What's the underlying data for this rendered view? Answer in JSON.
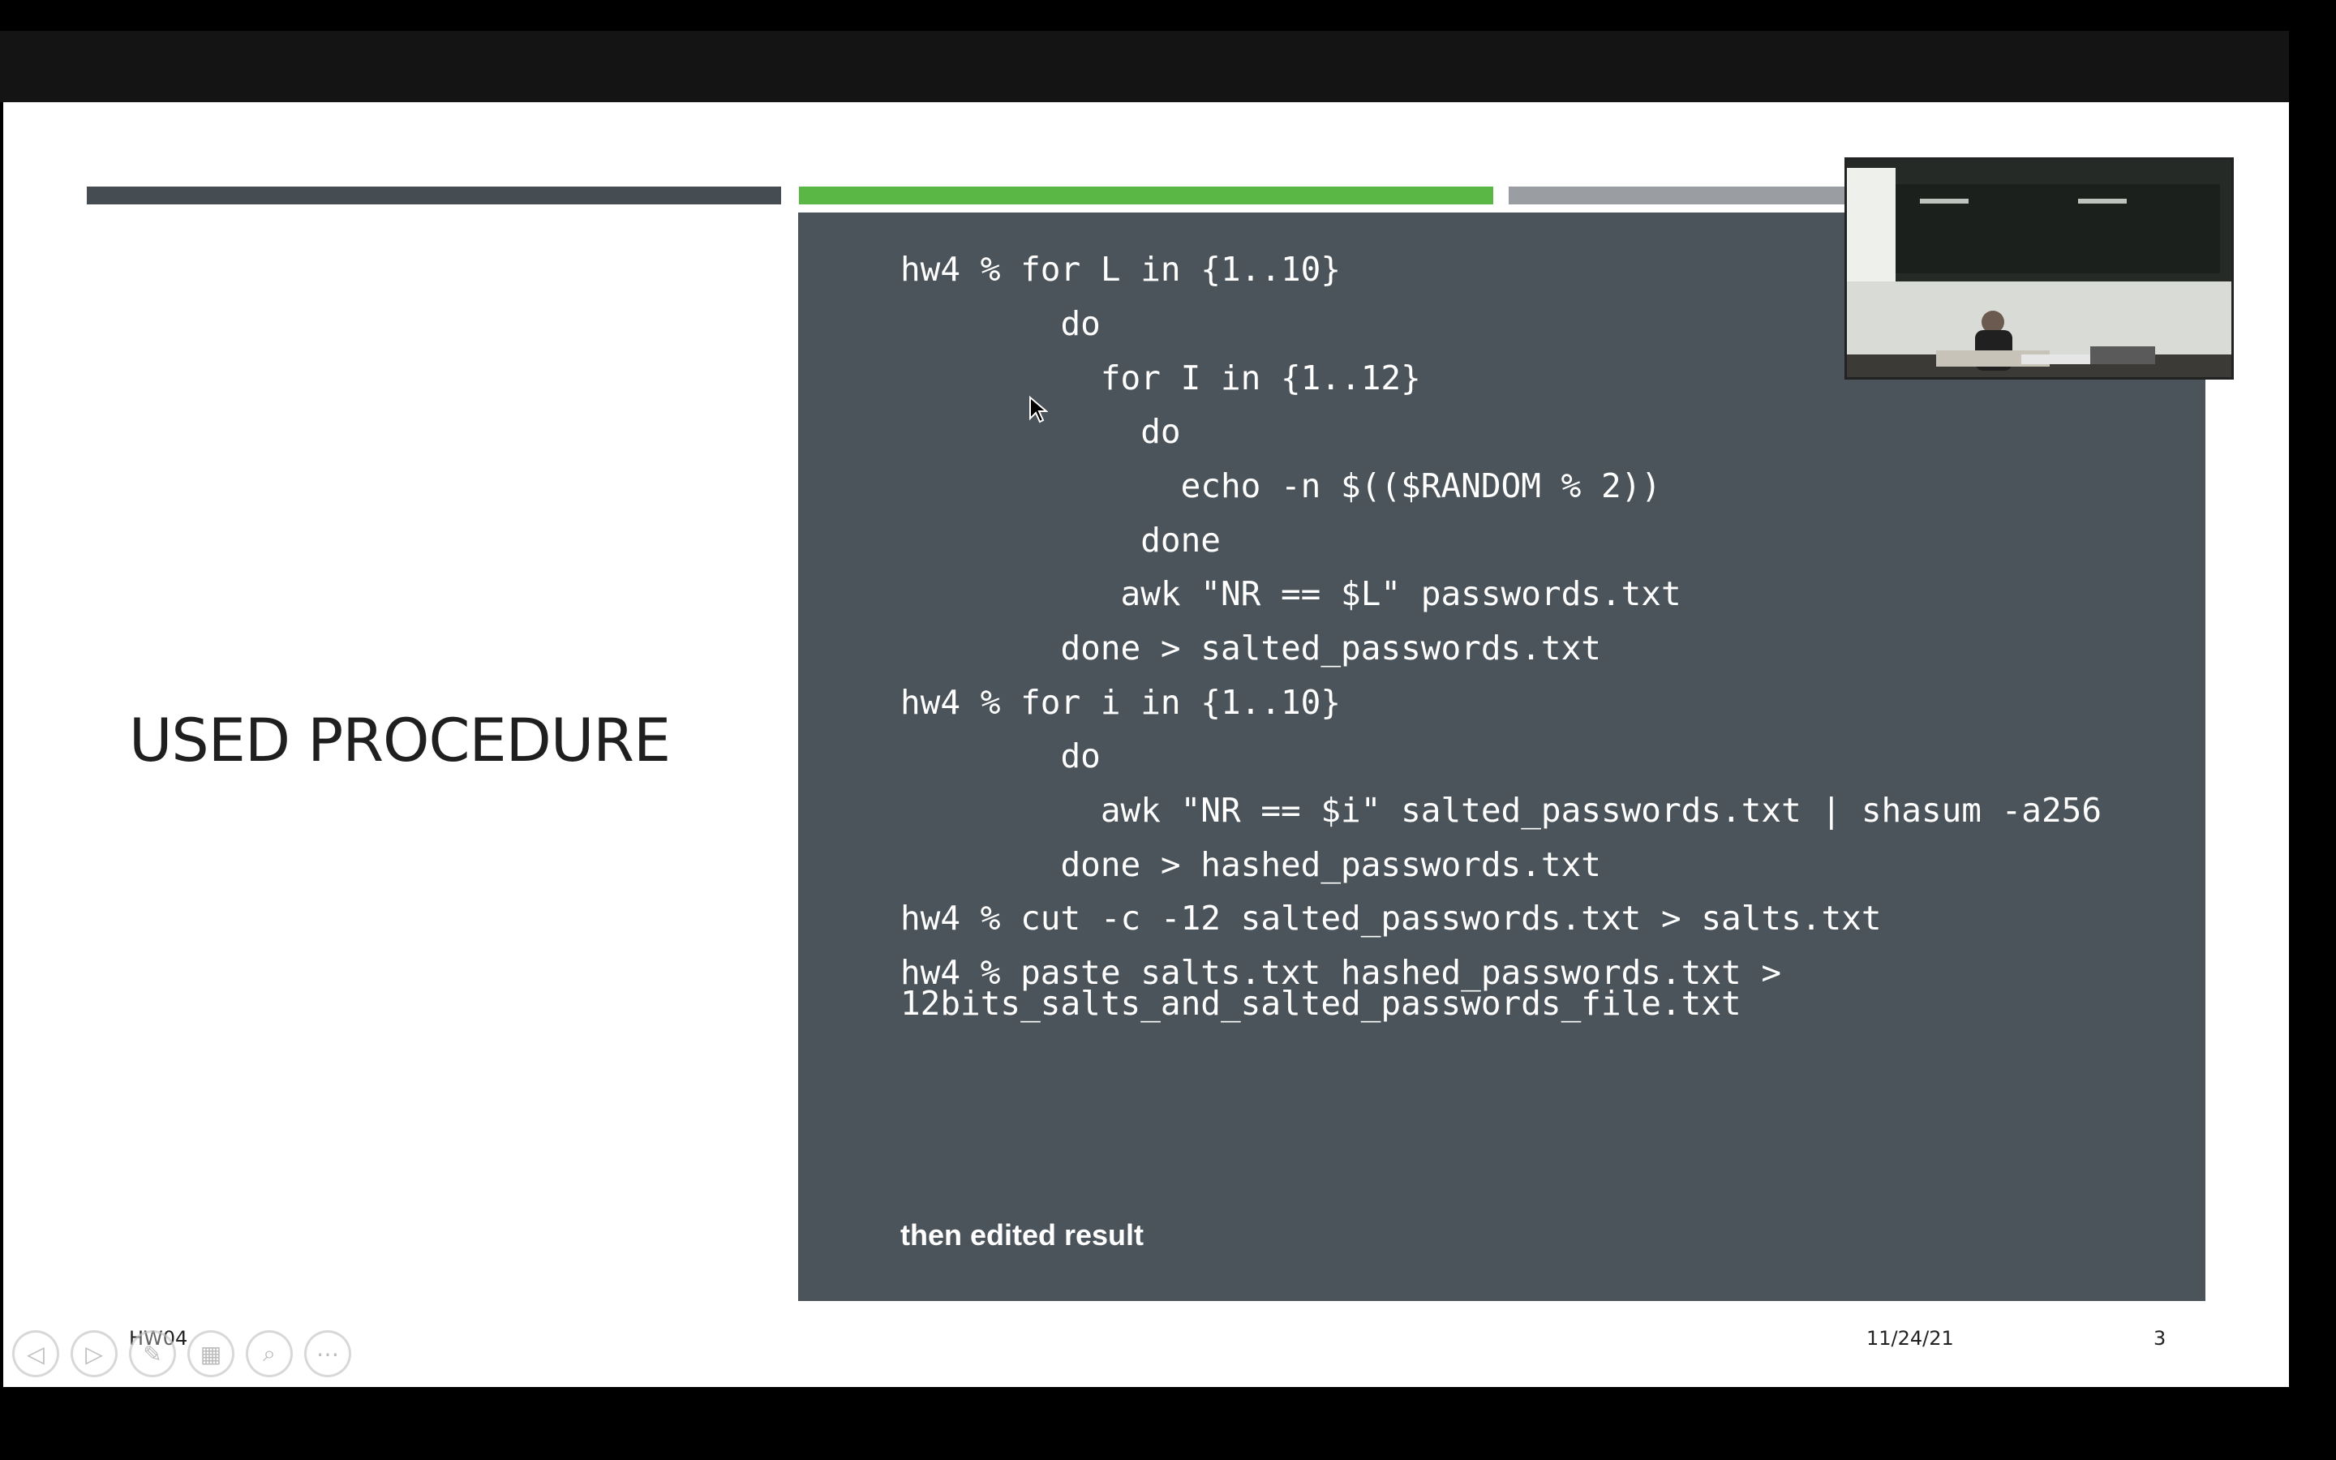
{
  "slide": {
    "title": "USED PROCEDURE",
    "code_lines": [
      "hw4 % for L in {1..10}",
      "        do",
      "          for I in {1..12}",
      "            do",
      "              echo -n $(($RANDOM % 2))",
      "            done",
      "           awk \"NR == $L\" passwords.txt",
      "        done > salted_passwords.txt",
      "hw4 % for i in {1..10}",
      "        do",
      "          awk \"NR == $i\" salted_passwords.txt | shasum -a256",
      "        done > hashed_passwords.txt",
      "hw4 % cut -c -12 salted_passwords.txt > salts.txt",
      "hw4 % paste salts.txt hashed_passwords.txt >",
      "12bits_salts_and_salted_passwords_file.txt"
    ],
    "result_note": "then edited result",
    "footer": {
      "left": "HW04",
      "date": "11/24/21",
      "page": "3"
    }
  },
  "nav_controls": [
    {
      "icon": "previous-icon",
      "glyph": "◁"
    },
    {
      "icon": "next-icon",
      "glyph": "▷"
    },
    {
      "icon": "pen-icon",
      "glyph": "✎"
    },
    {
      "icon": "slides-grid-icon",
      "glyph": "▦"
    },
    {
      "icon": "zoom-icon",
      "glyph": "⌕"
    },
    {
      "icon": "more-icon",
      "glyph": "⋯"
    }
  ],
  "colors": {
    "code_panel": "#4b545a",
    "accent_green": "#5bb745",
    "accent_dark": "#454c52",
    "accent_gray": "#9a9ea2"
  }
}
